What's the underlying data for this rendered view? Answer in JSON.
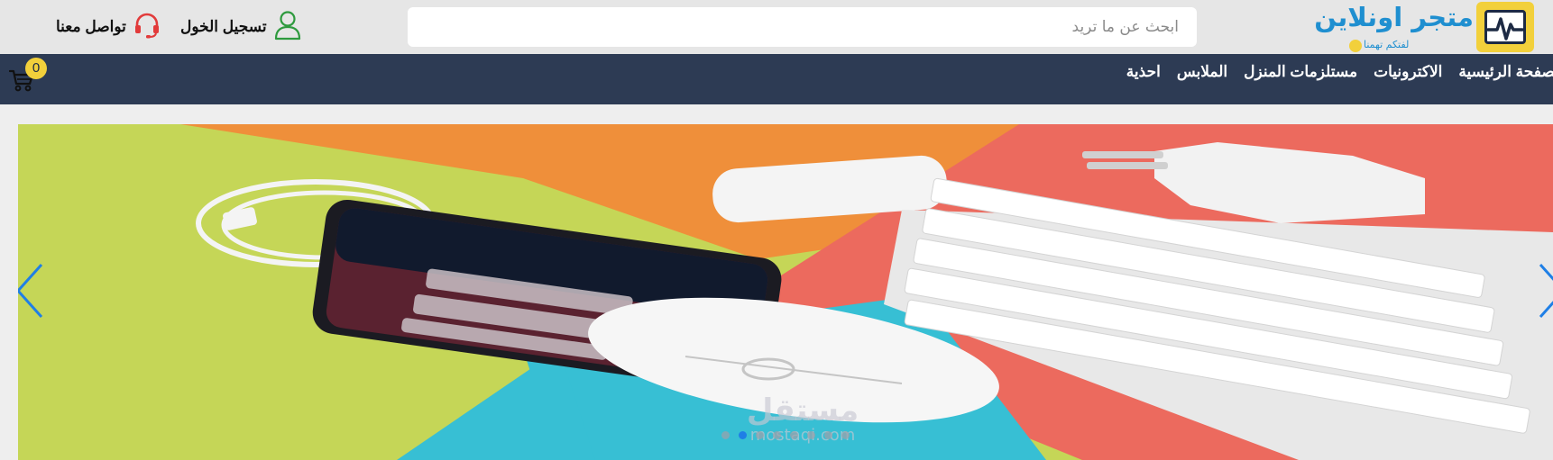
{
  "brand": {
    "name": "متجر اونلاين",
    "tagline": "لفتكم تهمنا",
    "colors": {
      "primary": "#1f8fd0",
      "accent": "#f2d03b",
      "dark": "#2d3b54"
    }
  },
  "search": {
    "placeholder": "ابحث عن ما تريد",
    "value": ""
  },
  "header": {
    "login_label": "تسجيل الخول",
    "contact_label": "تواصل معنا"
  },
  "nav": {
    "items": [
      "الصفحة الرئيسية",
      "الاكترونيات",
      "مستلزمات المنزل",
      "الملابس",
      "احذية"
    ]
  },
  "cart": {
    "count": "0"
  },
  "slider": {
    "watermark_main": "مستقل",
    "watermark_sub": "mostaqi.com",
    "dot_count": 8,
    "active_index": 0
  }
}
